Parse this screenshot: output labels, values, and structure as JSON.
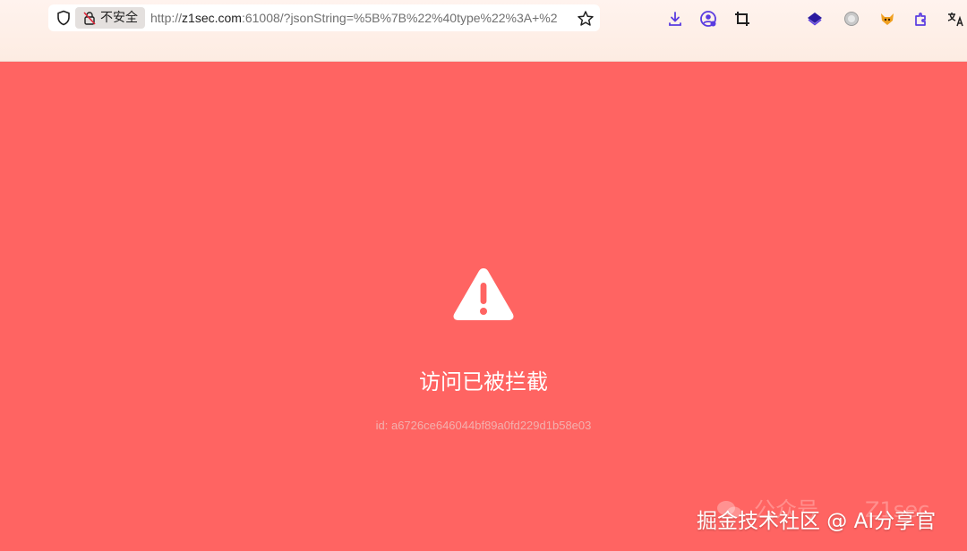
{
  "browser": {
    "security_label": "不安全",
    "url_host_prefix": "http://",
    "url_host": "z1sec.com",
    "url_rest": ":61008/?jsonString=%5B%7B%22%40type%22%3A+%2"
  },
  "extensions": [
    {
      "icon": "download-icon"
    },
    {
      "icon": "profile-icon"
    },
    {
      "icon": "crop-icon"
    },
    {
      "icon": "layers-icon"
    },
    {
      "icon": "silver-badge-icon"
    },
    {
      "icon": "fox-icon"
    },
    {
      "icon": "puzzle-icon"
    },
    {
      "icon": "translate-icon"
    }
  ],
  "page": {
    "title": "访问已被拦截",
    "incident_id": "id: a6726ce646044bf89a0fd229d1b58e03",
    "background_color": "#ff6462"
  },
  "watermark": {
    "wechat_label": "公众号",
    "wechat_account": "Z1sec",
    "footer": "掘金技术社区 @ AI分享官"
  }
}
